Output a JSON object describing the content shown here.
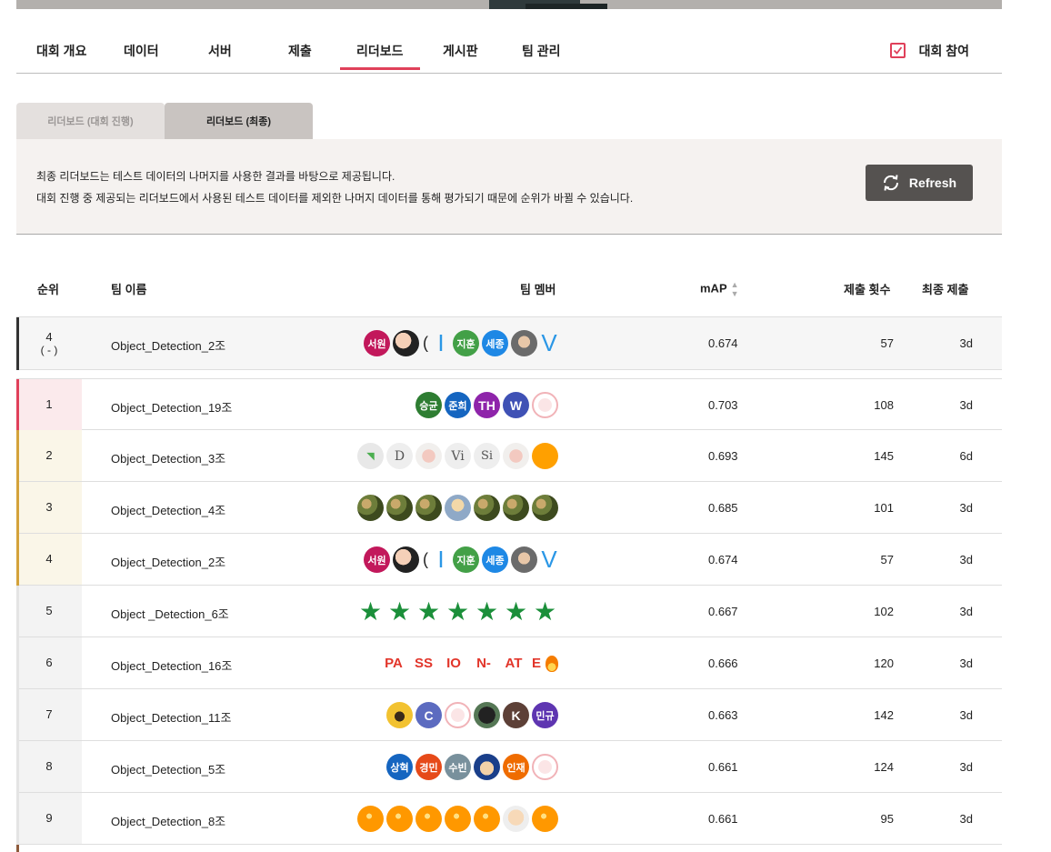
{
  "nav": {
    "tabs": [
      "대회 개요",
      "데이터",
      "서버",
      "제출",
      "리더보드",
      "게시판",
      "팀 관리"
    ],
    "active_tab": "리더보드",
    "join_label": "대회 참여"
  },
  "subtabs": {
    "inactive": "리더보드 (대회 진행)",
    "active": "리더보드 (최종)"
  },
  "info": {
    "line1": "최종 리더보드는 테스트 데이터의 나머지를 사용한 결과를 바탕으로 제공됩니다.",
    "line2": "대회 진행 중 제공되는 리더보드에서 사용된 테스트 데이터를 제외한 나머지 데이터를 통해 평가되기 때문에 순위가 바뀔 수 있습니다.",
    "refresh_label": "Refresh"
  },
  "table": {
    "headers": {
      "rank": "순위",
      "team_name": "팀 이름",
      "team_members": "팀 멤버",
      "score": "mAP",
      "submissions": "제출 횟수",
      "last_submit": "최종 제출"
    },
    "my_team": {
      "rank": "4",
      "rank_change": "( - )",
      "name": "Object_Detection_2조",
      "score": "0.674",
      "submissions": "57",
      "last": "3d"
    },
    "rows": [
      {
        "rank": "1",
        "name": "Object_Detection_19조",
        "score": "0.703",
        "submissions": "108",
        "last": "3d"
      },
      {
        "rank": "2",
        "name": "Object_Detection_3조",
        "score": "0.693",
        "submissions": "145",
        "last": "6d"
      },
      {
        "rank": "3",
        "name": "Object_Detection_4조",
        "score": "0.685",
        "submissions": "101",
        "last": "3d"
      },
      {
        "rank": "4",
        "name": "Object_Detection_2조",
        "score": "0.674",
        "submissions": "57",
        "last": "3d"
      },
      {
        "rank": "5",
        "name": "Object _Detection_6조",
        "score": "0.667",
        "submissions": "102",
        "last": "3d"
      },
      {
        "rank": "6",
        "name": "Object_Detection_16조",
        "score": "0.666",
        "submissions": "120",
        "last": "3d"
      },
      {
        "rank": "7",
        "name": "Object_Detection_11조",
        "score": "0.663",
        "submissions": "142",
        "last": "3d"
      },
      {
        "rank": "8",
        "name": "Object_Detection_5조",
        "score": "0.661",
        "submissions": "124",
        "last": "3d"
      },
      {
        "rank": "9",
        "name": "Object_Detection_8조",
        "score": "0.661",
        "submissions": "95",
        "last": "3d"
      }
    ]
  },
  "avatars": {
    "team2": [
      "서원",
      "",
      "",
      "",
      "지훈",
      "세종",
      "",
      "V"
    ],
    "team2_letters": {
      "i_char": "I"
    },
    "team19": [
      "승균",
      "준희",
      "TH",
      "W",
      ""
    ],
    "team3": [
      "",
      "D",
      "",
      "Vi",
      "Si",
      "",
      ""
    ],
    "team16": [
      "PA",
      "SS",
      "IO",
      "N-",
      "AT",
      "E"
    ],
    "team11": [
      "",
      "C",
      "",
      "",
      "K",
      "민규"
    ],
    "team5": [
      "상혁",
      "경민",
      "수빈",
      "",
      "인재",
      ""
    ]
  },
  "colors": {
    "accent": "#e0405a",
    "rank1": "#e0405a",
    "rank2to4": "#d4a23a",
    "my_team": "#333333",
    "refresh_bg": "#555250"
  }
}
